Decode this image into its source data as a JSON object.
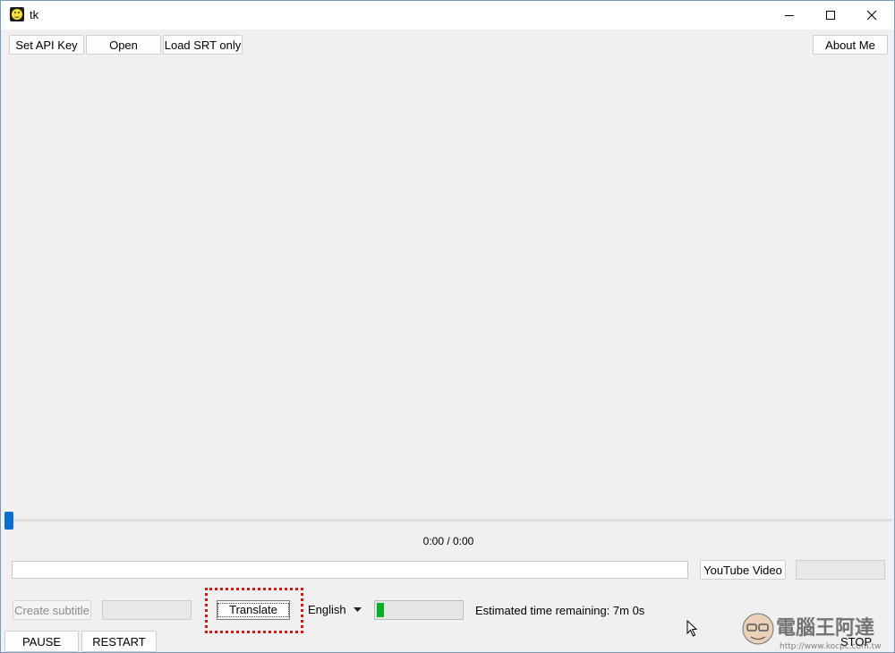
{
  "window": {
    "title": "tk",
    "icon": "smiley-icon",
    "controls": [
      "minimize-icon",
      "maximize-icon",
      "close-icon"
    ]
  },
  "toolbar": {
    "set_api_key": "Set API Key",
    "open": "Open",
    "load_srt": "Load SRT only",
    "about": "About Me"
  },
  "player": {
    "time": "0:00 / 0:00",
    "seek_position": 0
  },
  "url_row": {
    "url_value": "",
    "youtube_button": "YouTube Video"
  },
  "controls_row": {
    "create_subtitle": "Create subtitle",
    "translate": "Translate",
    "language": "English",
    "progress_fraction": 0.08,
    "progress_color": "#06b025",
    "eta": "Estimated time remaining: 7m 0s"
  },
  "bottom_row": {
    "pause": "PAUSE",
    "restart": "RESTART",
    "stop": "STOP"
  },
  "highlight_color": "#d01818",
  "watermark": {
    "text": "電腦王阿達",
    "url": "http://www.kocpc.com.tw"
  }
}
